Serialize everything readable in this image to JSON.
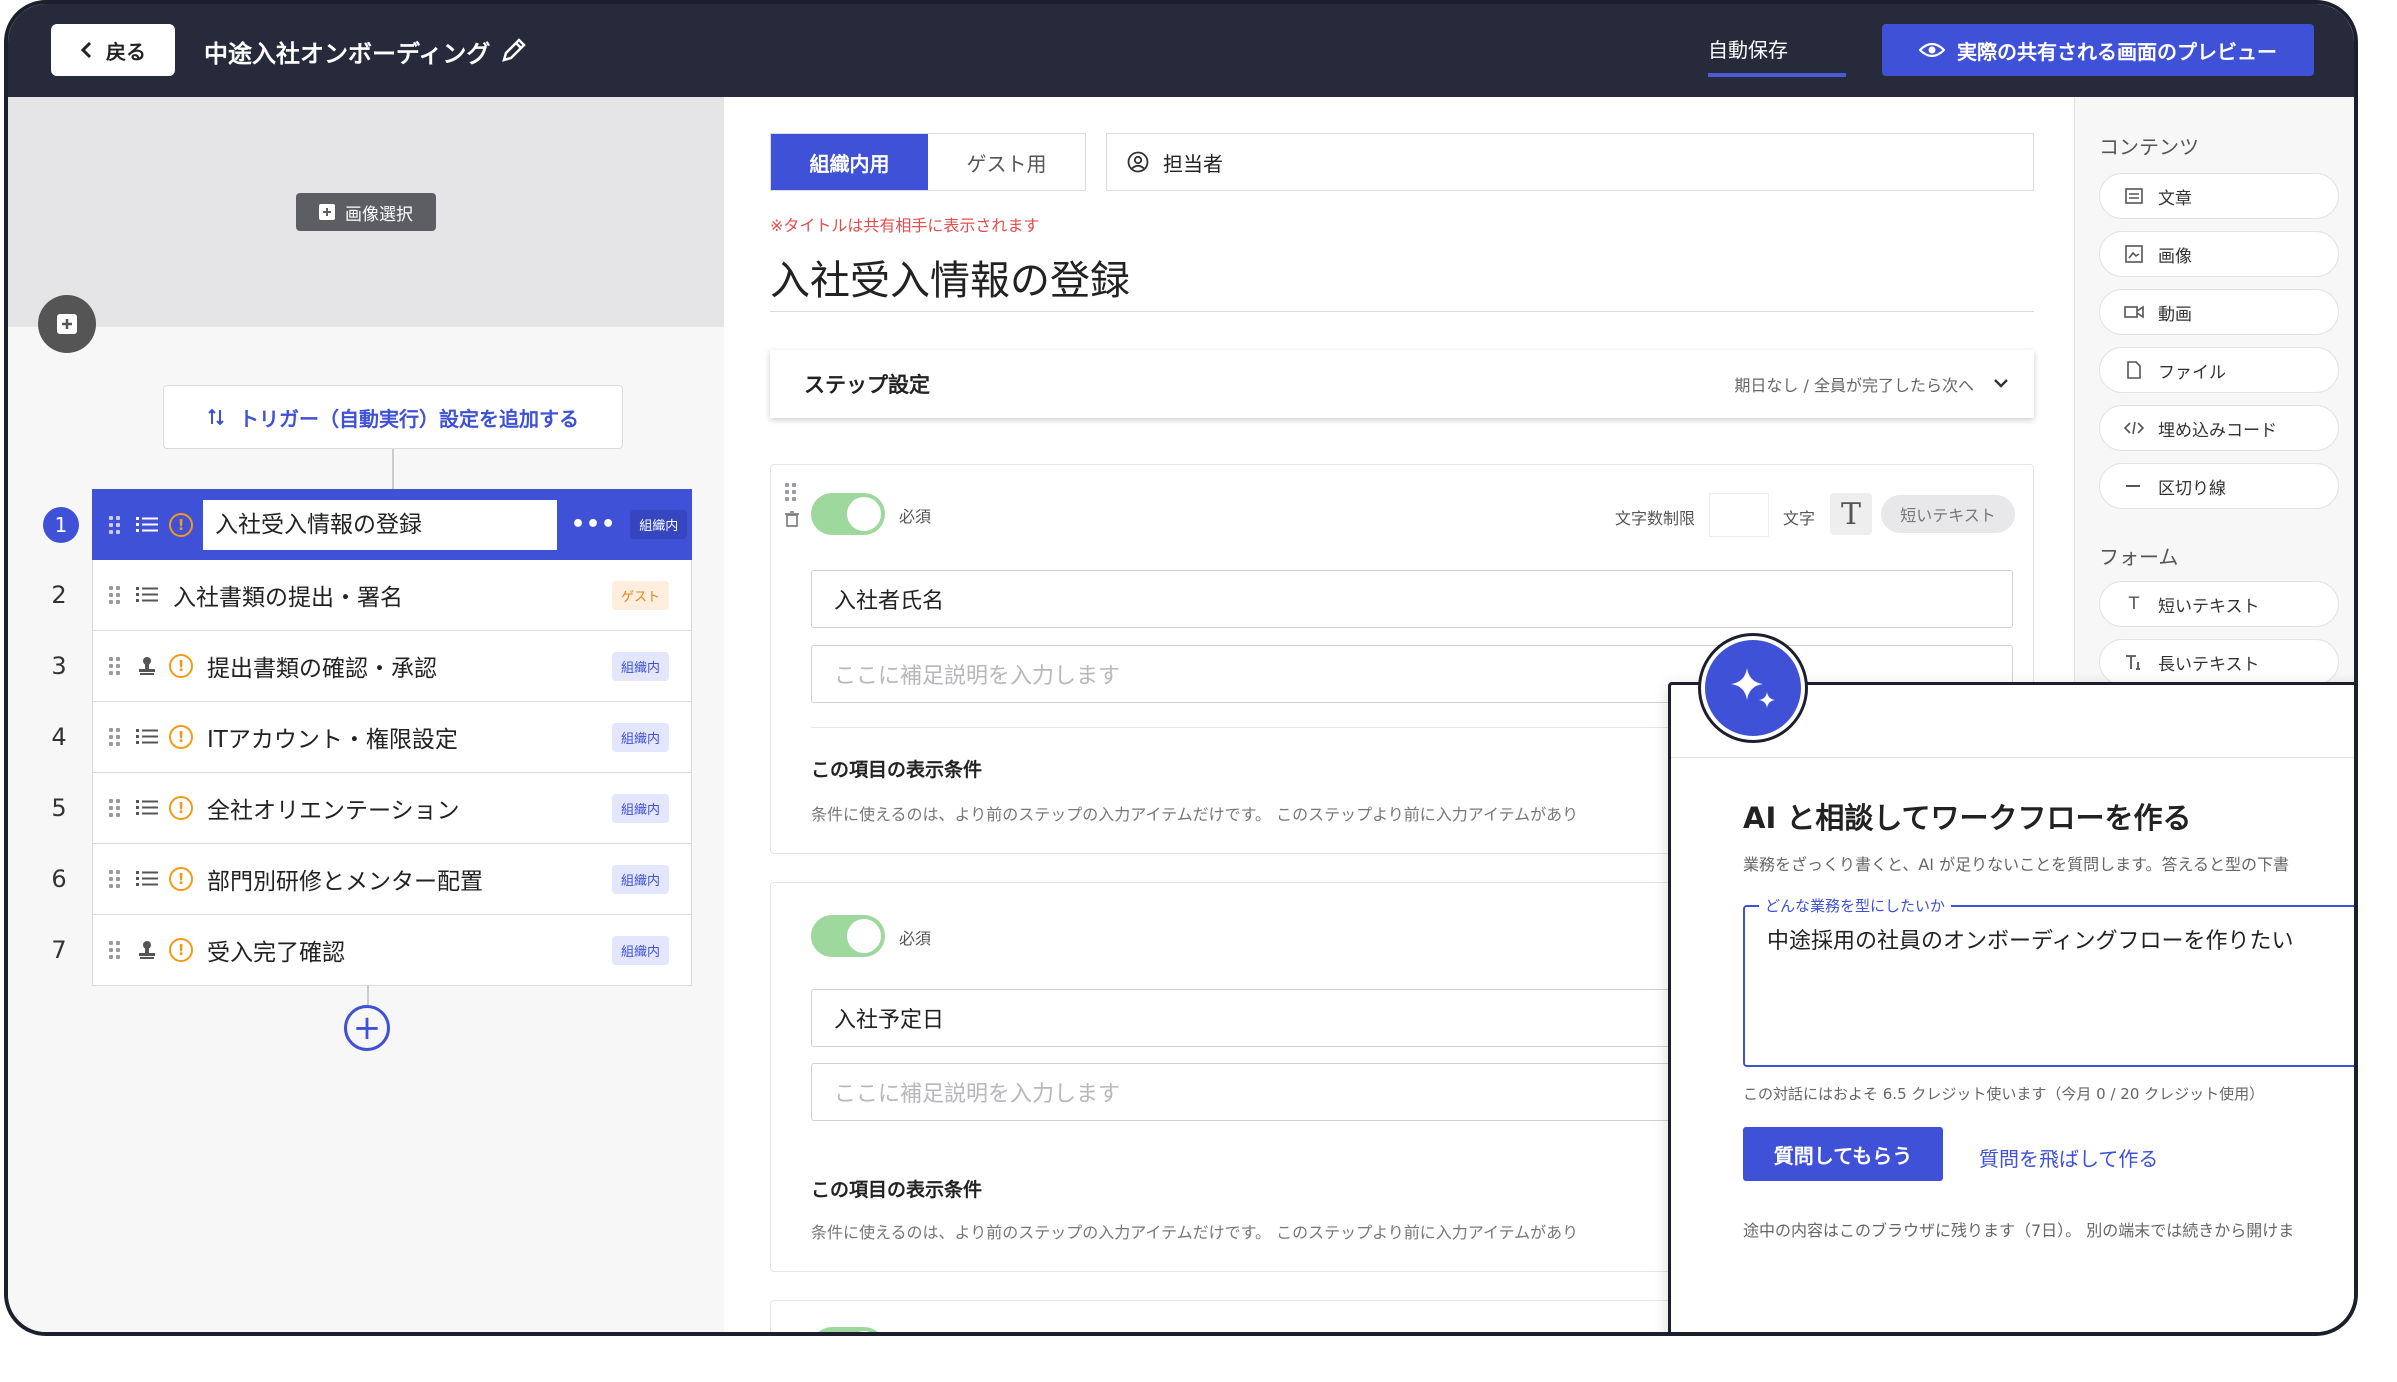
{
  "header": {
    "back_label": "戻る",
    "title": "中途入社オンボーディング",
    "autosave": "自動保存",
    "preview_label": "実際の共有される画面のプレビュー"
  },
  "left": {
    "image_select": "画像選択",
    "trigger_label": "トリガー（自動実行）設定を追加する",
    "steps": [
      {
        "num": "1",
        "label": "入社受入情報の登録",
        "badge": "組織内"
      },
      {
        "num": "2",
        "label": "入社書類の提出・署名",
        "badge": "ゲスト"
      },
      {
        "num": "3",
        "label": "提出書類の確認・承認",
        "badge": "組織内"
      },
      {
        "num": "4",
        "label": "ITアカウント・権限設定",
        "badge": "組織内"
      },
      {
        "num": "5",
        "label": "全社オリエンテーション",
        "badge": "組織内"
      },
      {
        "num": "6",
        "label": "部門別研修とメンター配置",
        "badge": "組織内"
      },
      {
        "num": "7",
        "label": "受入完了確認",
        "badge": "組織内"
      }
    ],
    "more": "•••"
  },
  "main": {
    "tab_internal": "組織内用",
    "tab_guest": "ゲスト用",
    "assignee": "担当者",
    "title_note": "※タイトルは共有相手に表示されます",
    "step_title": "入社受入情報の登録",
    "settings_label": "ステップ設定",
    "settings_summary": "期日なし / 全員が完了したら次へ",
    "card1": {
      "required": "必須",
      "char_limit": "文字数制限",
      "char_unit": "文字",
      "type_icon": "T",
      "type_chip": "短いテキスト",
      "field_value": "入社者氏名",
      "desc_placeholder": "ここに補足説明を入力します",
      "cond_title": "この項目の表示条件",
      "cond_desc": "条件に使えるのは、より前のステップの入力アイテムだけです。 このステップより前に入力アイテムがあり"
    },
    "card2": {
      "required": "必須",
      "field_value": "入社予定日",
      "desc_placeholder": "ここに補足説明を入力します",
      "cond_title": "この項目の表示条件",
      "cond_desc": "条件に使えるのは、より前のステップの入力アイテムだけです。 このステップより前に入力アイテムがあり"
    }
  },
  "right": {
    "contents_head": "コンテンツ",
    "contents": [
      "文章",
      "画像",
      "動画",
      "ファイル",
      "埋め込みコード",
      "区切り線"
    ],
    "form_head": "フォーム",
    "forms": [
      "短いテキスト",
      "長いテキスト"
    ]
  },
  "ai": {
    "title": "AI と相談してワークフローを作る",
    "desc": "業務をざっくり書くと、AI が足りないことを質問します。答えると型の下書",
    "box_legend": "どんな業務を型にしたいか",
    "box_text": "中途採用の社員のオンボーディングフローを作りたい",
    "credit": "この対話にはおよそ 6.5 クレジット使います（今月 0 / 20 クレジット使用）",
    "ask_label": "質問してもらう",
    "skip_label": "質問を飛ばして作る",
    "note": "途中の内容はこのブラウザに残ります（7日）。 別の端末では続きから開けま"
  }
}
